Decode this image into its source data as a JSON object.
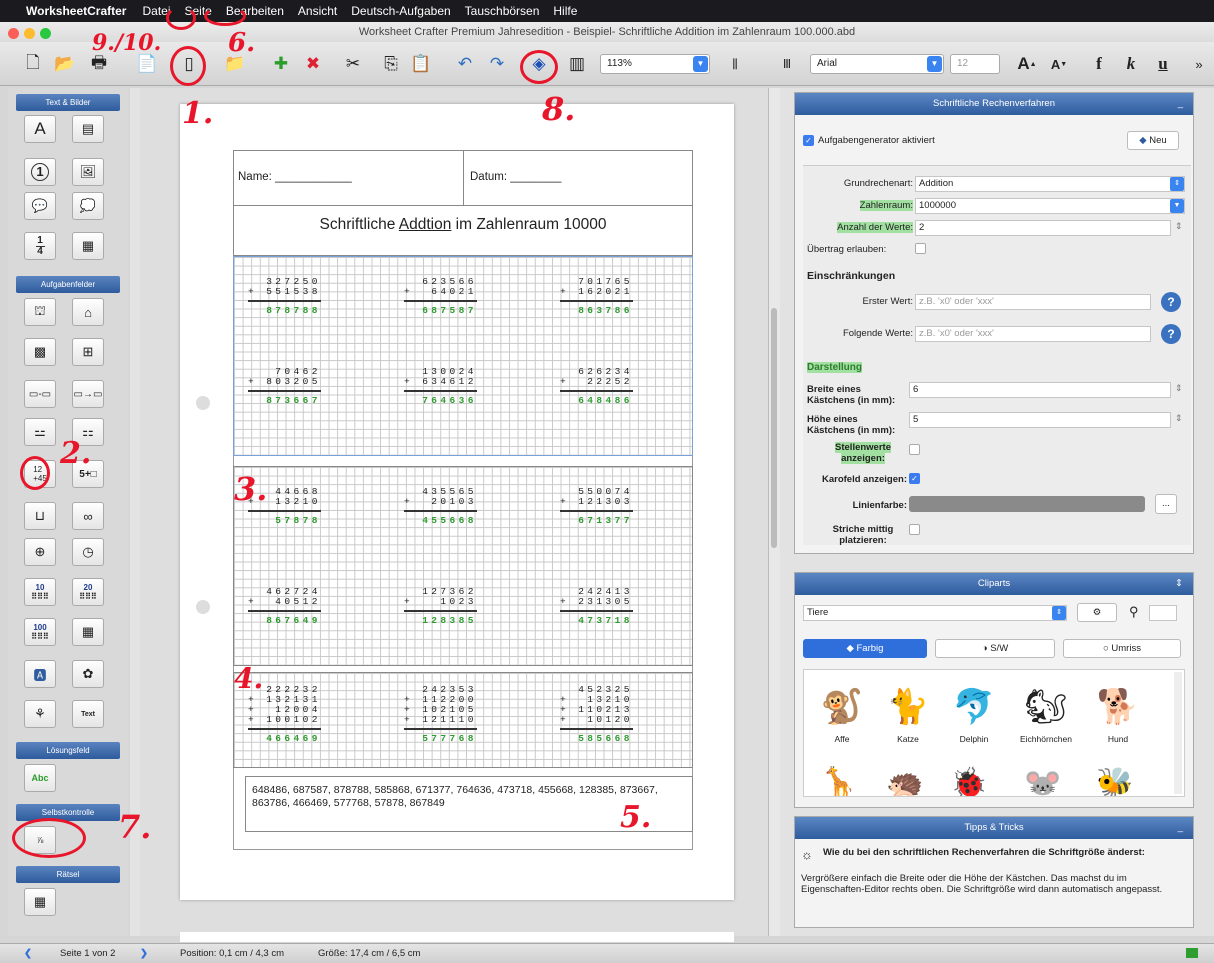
{
  "menubar": {
    "app": "WorksheetCrafter",
    "items": [
      "Datei",
      "Seite",
      "Bearbeiten",
      "Ansicht",
      "Deutsch-Aufgaben",
      "Tauschbörsen",
      "Hilfe"
    ]
  },
  "window_title": "Worksheet Crafter Premium Jahresedition - Beispiel- Schriftliche Addition im Zahlenraum 100.000.abd",
  "toolbar": {
    "zoom": "113%",
    "font": "Arial",
    "font_size": "12",
    "bold": "f",
    "italic": "k",
    "underline": "u",
    "more": "»"
  },
  "left_panel": {
    "text_images": "Text & Bilder",
    "task_fields": "Aufgabenfelder",
    "solution_field": "Lösungsfeld",
    "self_check": "Selbstkontrolle",
    "puzzle": "Rätsel",
    "numbers": {
      "n10": "10",
      "n20": "20",
      "n100": "100"
    },
    "solution_button": "Abc",
    "text_button": "Text",
    "sum_glyph": "5+□",
    "text_glyph": "A",
    "one_glyph": "1",
    "fraction_top": "1",
    "fraction_bottom": "4"
  },
  "worksheet": {
    "name_label": "Name: ____________",
    "date_label": "Datum: ________",
    "title_prefix": "Schriftliche ",
    "title_word": "Addtion",
    "title_suffix": " im Zahlenraum 10000",
    "block1": [
      {
        "a": "  327250",
        "b": "+ 551538",
        "r": "  878788"
      },
      {
        "a": "  623566",
        "b": "+  64021",
        "r": "  687587"
      },
      {
        "a": "  701765",
        "b": "+ 162021",
        "r": "  863786"
      },
      {
        "a": "   70462",
        "b": "+ 803205",
        "r": "  873667"
      },
      {
        "a": "  130024",
        "b": "+ 634612",
        "r": "  764636"
      },
      {
        "a": "  626234",
        "b": "+  22252",
        "r": "  648486"
      }
    ],
    "block2": [
      {
        "a": "   44668",
        "b": "+  13210",
        "r": "   57878"
      },
      {
        "a": "  435565",
        "b": "+  20103",
        "r": "  455668"
      },
      {
        "a": "  550074",
        "b": "+ 121303",
        "r": "  671377"
      },
      {
        "a": "  462724",
        "b": "+  40512",
        "r": "  867649"
      },
      {
        "a": "  127362",
        "b": "+   1023",
        "r": "  128385"
      },
      {
        "a": "  242413",
        "b": "+ 231305",
        "r": "  473718"
      }
    ],
    "block3": [
      {
        "a": "  222232",
        "b": "+ 132131",
        "c": "+  12004",
        "d": "+ 100102",
        "r": "  466469"
      },
      {
        "a": "  242353",
        "b": "+ 112200",
        "c": "+ 102105",
        "d": "+ 121110",
        "r": "  577768"
      },
      {
        "a": "  452325",
        "b": "+  13210",
        "c": "+ 110213",
        "d": "+  10120",
        "r": "  585668"
      }
    ],
    "solutions": "648486, 687587, 878788, 585868, 671377, 764636, 473718, 455668, 128385, 873667, 863786, 466469, 577768, 57878, 867849"
  },
  "properties": {
    "title": "Schriftliche Rechenverfahren",
    "generator_label": "Aufgabengenerator aktiviert",
    "new_button": "Neu",
    "operation_label": "Grundrechenart:",
    "operation_value": "Addition",
    "range_label": "Zahlenraum:",
    "range_value": "1000000",
    "count_label": "Anzahl der Werte:",
    "count_value": "2",
    "carry_label": "Übertrag erlauben:",
    "restrictions_title": "Einschränkungen",
    "first_label": "Erster Wert:",
    "first_placeholder": "z.B. 'x0' oder 'xxx'",
    "following_label": "Folgende Werte:",
    "following_placeholder": "z.B. 'x0' oder 'xxx'",
    "display_title": "Darstellung",
    "box_width_label": "Breite eines Kästchens (in mm):",
    "box_width_value": "6",
    "box_height_label": "Höhe eines Kästchens (in mm):",
    "box_height_value": "5",
    "place_values_label": "Stellenwerte anzeigen:",
    "grid_label": "Karofeld anzeigen:",
    "line_color_label": "Linienfarbe:",
    "line_color": "#8a8a8a",
    "center_lines_label": "Striche mittig platzieren:",
    "more": "...",
    "help": "?"
  },
  "cliparts": {
    "title": "Cliparts",
    "category": "Tiere",
    "tabs": [
      "Farbig",
      "S/W",
      "Umriss"
    ],
    "items": [
      "Affe",
      "Katze",
      "Delphin",
      "Eichhörnchen",
      "Hund"
    ],
    "icons": [
      "monkey-icon",
      "cat-icon",
      "dolphin-icon",
      "squirrel-icon",
      "dog-icon"
    ]
  },
  "tips": {
    "title": "Tipps & Tricks",
    "heading": "Wie du bei den schriftlichen Rechenverfahren die Schriftgröße änderst:",
    "body": "Vergrößere einfach die Breite oder die Höhe der Kästchen. Das machst du im Eigenschaften-Editor rechts oben. Die Schriftgröße wird dann automatisch angepasst."
  },
  "status": {
    "page": "Seite 1 von 2",
    "position": "Position: 0,1 cm / 4,3 cm",
    "size": "Größe: 17,4 cm / 6,5 cm"
  },
  "annotations": [
    "1.",
    "2.",
    "3.",
    "4.",
    "5.",
    "6.",
    "7.",
    "8.",
    "9./10."
  ],
  "colors": {
    "accent": "#2f5c9e",
    "result_green": "#2e9c2e",
    "annotation_red": "#e8162a",
    "highlight": "#46d246"
  }
}
